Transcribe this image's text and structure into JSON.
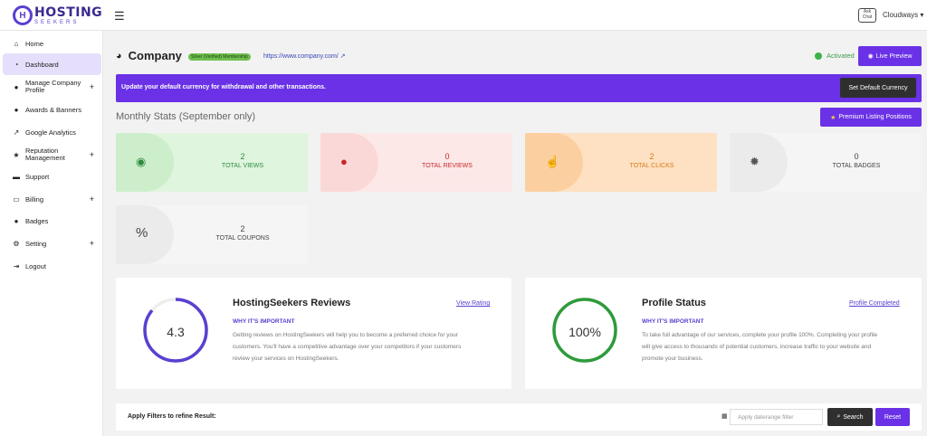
{
  "header": {
    "logo_main": "HOSTING",
    "logo_sub": "SEEKERS",
    "chat_label": "Ask Chat",
    "user_name": "Cloudways"
  },
  "sidebar": {
    "items": [
      {
        "label": "Home",
        "icon": "home-icon"
      },
      {
        "label": "Dashboard",
        "icon": "dashboard-icon"
      },
      {
        "label": "Manage Company Profile",
        "icon": "info-icon"
      },
      {
        "label": "Awards & Banners",
        "icon": "award-icon"
      },
      {
        "label": "Google Analytics",
        "icon": "chart-icon"
      },
      {
        "label": "Reputation Management",
        "icon": "star-icon"
      },
      {
        "label": "Support",
        "icon": "support-icon"
      },
      {
        "label": "Billing",
        "icon": "billing-icon"
      },
      {
        "label": "Badges",
        "icon": "badge-icon"
      },
      {
        "label": "Setting",
        "icon": "gear-icon"
      },
      {
        "label": "Logout",
        "icon": "logout-icon"
      }
    ]
  },
  "company": {
    "name": "Company",
    "membership": "Silver (Verified) Membership",
    "url": "https://www.company.com/",
    "status": "Activated",
    "live_preview": "Live Preview"
  },
  "banner": {
    "message": "Update your default currency for withdrawal and other transactions.",
    "button": "Set Default Currency"
  },
  "stats": {
    "title": "Monthly Stats (September only)",
    "premium_button": "Premium Listing Positions",
    "cards": [
      {
        "value": "2",
        "label": "TOTAL VIEWS"
      },
      {
        "value": "0",
        "label": "TOTAL REVIEWS"
      },
      {
        "value": "2",
        "label": "TOTAL CLICKS"
      },
      {
        "value": "0",
        "label": "TOTAL BADGES"
      },
      {
        "value": "2",
        "label": "TOTAL COUPONS"
      }
    ]
  },
  "reviews": {
    "score": "4.3",
    "score_fraction": 0.86,
    "title": "HostingSeekers Reviews",
    "link": "View Rating",
    "why": "WHY IT'S IMPORTANT",
    "lines": [
      "Getting reviews on HostingSeekers will help you to become a preferred choice for your",
      "customers. You'll have a competitive advantage over your competitors if your customers",
      "review your services on HostingSeekers."
    ]
  },
  "profile": {
    "percent": "100%",
    "fraction": 1.0,
    "title": "Profile Status",
    "link": "Profile Completed",
    "why": "WHY IT'S IMPORTANT",
    "lines": [
      "To take full advantage of our services, complete your profile 100%. Completing your profile",
      "will give access to thousands of potential customers, increase traffic to your website and",
      "promote your business."
    ]
  },
  "filter": {
    "label": "Apply Filters to refine Result:",
    "date_placeholder": "Apply daterange filter",
    "search": "Search",
    "reset": "Reset"
  },
  "colors": {
    "accent": "#6a31e6",
    "views_bg": "#dff5de",
    "reviews_bg": "#fde8e8",
    "clicks_bg": "#fde1c2",
    "badges_bg": "#f5f5f5"
  }
}
